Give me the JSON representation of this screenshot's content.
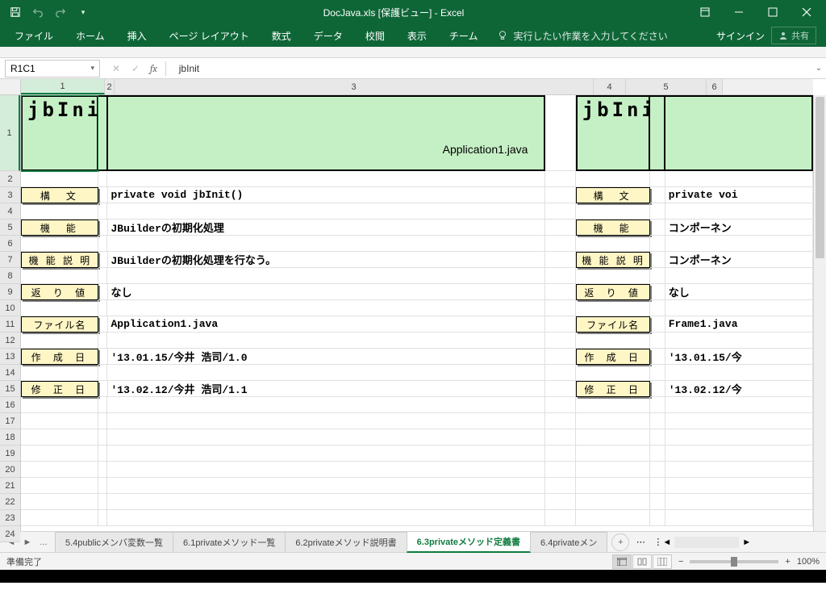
{
  "title": "DocJava.xls  [保護ビュー]  - Excel",
  "ribbon": {
    "file": "ファイル",
    "home": "ホーム",
    "insert": "挿入",
    "pagelayout": "ページ レイアウト",
    "formulas": "数式",
    "data": "データ",
    "review": "校閲",
    "view": "表示",
    "team": "チーム",
    "tellme": "実行したい作業を入力してください",
    "signin": "サインイン",
    "share": "共有"
  },
  "formulabar": {
    "namebox": "R1C1",
    "fx": "fx",
    "value": "jbInit"
  },
  "columns": [
    "1",
    "2",
    "3",
    "4",
    "5",
    "6"
  ],
  "rows": [
    "1",
    "2",
    "3",
    "4",
    "5",
    "6",
    "7",
    "8",
    "9",
    "10",
    "11",
    "12",
    "13",
    "14",
    "15",
    "16",
    "17",
    "18",
    "19",
    "20",
    "21",
    "22",
    "23",
    "24"
  ],
  "cells": {
    "a1": "jbInit",
    "subtitle": "Application1.java",
    "e1": "jbInit",
    "labels": {
      "syntax": "構　文",
      "function": "機　能",
      "funcdesc": "機 能 説 明",
      "return": "返 り 値",
      "filename": "ファイル名",
      "created": "作 成 日",
      "modified": "修 正 日"
    },
    "left": {
      "syntax": "private void jbInit()",
      "function": "JBuilderの初期化処理",
      "funcdesc": "JBuilderの初期化処理を行なう。",
      "return": "なし",
      "filename": "Application1.java",
      "created": "'13.01.15/今井 浩司/1.0",
      "modified": "'13.02.12/今井 浩司/1.1"
    },
    "right": {
      "syntax": "private voi",
      "function": "コンポーネン",
      "funcdesc": "コンポーネン",
      "return": "なし",
      "filename": "Frame1.java",
      "created": "'13.01.15/今",
      "modified": "'13.02.12/今"
    }
  },
  "tabs": {
    "t1": "5.4publicメンバ変数一覧",
    "t2": "6.1privateメソッド一覧",
    "t3": "6.2privateメソッド説明書",
    "t4": "6.3privateメソッド定義書",
    "t5": "6.4privateメン"
  },
  "status": {
    "ready": "準備完了",
    "zoom": "100%"
  }
}
